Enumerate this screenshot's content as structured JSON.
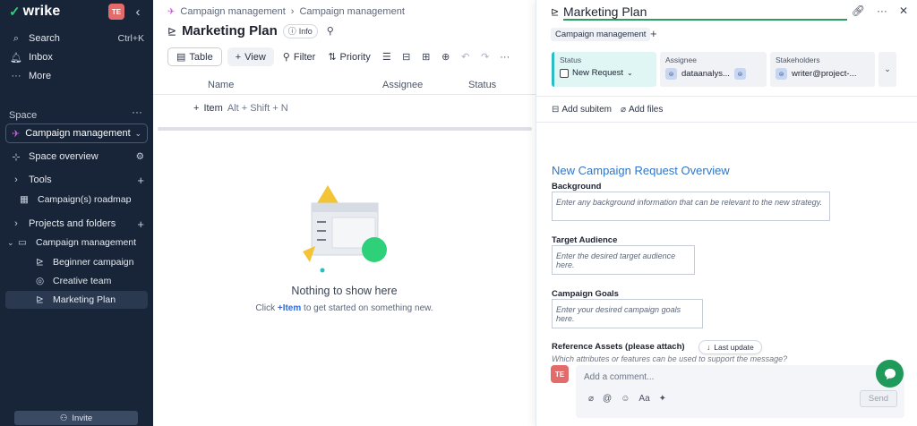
{
  "sidebar": {
    "logo": "wrike",
    "avatar": "TE",
    "search": {
      "label": "Search",
      "shortcut": "Ctrl+K"
    },
    "inbox": "Inbox",
    "more": "More",
    "space_label": "Space",
    "space_select": "Campaign management",
    "space_overview": "Space overview",
    "tools": "Tools",
    "tools_child": "Campaign(s) roadmap",
    "projects_folders": "Projects and folders",
    "folder": "Campaign management",
    "folder_items": [
      "Beginner campaign",
      "Creative team",
      "Marketing Plan"
    ],
    "invite": "Invite"
  },
  "main": {
    "breadcrumb": [
      "Campaign management",
      "Campaign management"
    ],
    "title": "Marketing Plan",
    "info": "Info",
    "toolbar": {
      "table": "Table",
      "view": "View",
      "filter": "Filter",
      "priority": "Priority"
    },
    "columns": [
      "Name",
      "Assignee",
      "Status"
    ],
    "add_item": {
      "label": "Item",
      "shortcut": "Alt + Shift + N"
    },
    "empty_title": "Nothing to show here",
    "empty_sub_prefix": "Click ",
    "empty_sub_link": "+Item",
    "empty_sub_suffix": " to get started on something new."
  },
  "panel": {
    "title": "Marketing Plan",
    "tag": "Campaign management",
    "status_label": "Status",
    "status_value": "New Request",
    "assignee_label": "Assignee",
    "assignee_value": "dataanalys...",
    "stakeholders_label": "Stakeholders",
    "stakeholders_value": "writer@project-...",
    "add_subitem": "Add subitem",
    "add_files": "Add files",
    "doc_heading": "New Campaign Request Overview",
    "sections": [
      {
        "label": "Background",
        "placeholder": "Enter any background information that can be relevant to the new strategy."
      },
      {
        "label": "Target Audience",
        "placeholder": "Enter the desired target audience here."
      },
      {
        "label": "Campaign Goals",
        "placeholder": "Enter your desired campaign goals here."
      },
      {
        "label": "Reference Assets (please attach)",
        "placeholder": ""
      }
    ],
    "hint": "Which attributes or features can be used to support the message?",
    "last_update": "Last update",
    "comment_avatar": "TE",
    "comment_placeholder": "Add a comment...",
    "send": "Send"
  },
  "colors": {
    "sidebar_bg": "#182437",
    "accent_green": "#1f9a5a",
    "status_teal": "#2bbcc4",
    "link_blue": "#2f76c6"
  }
}
